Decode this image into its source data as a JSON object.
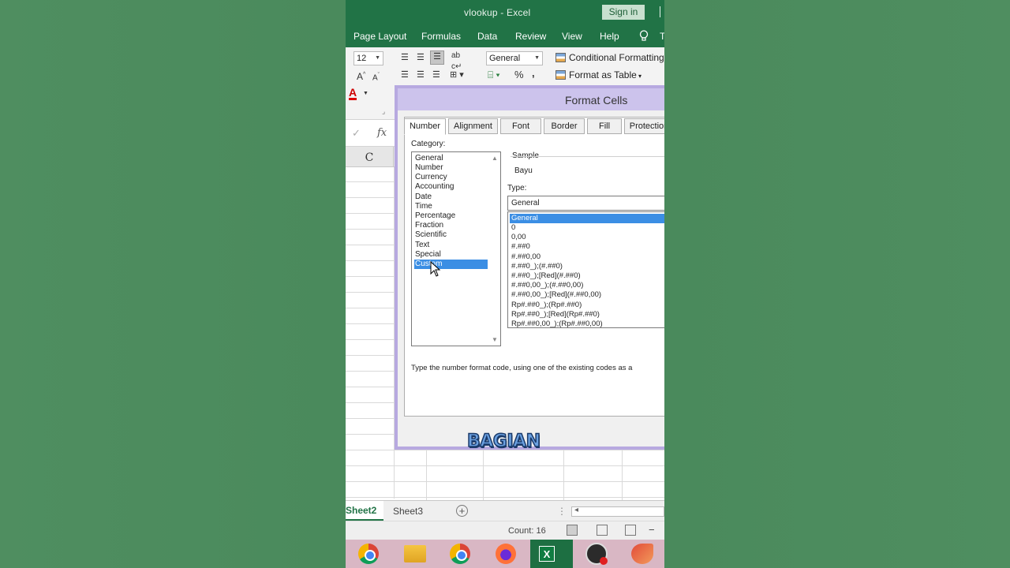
{
  "window": {
    "title": "vlookup - Excel",
    "sign_in": "Sign in"
  },
  "ribbon_tabs": [
    "Page Layout",
    "Formulas",
    "Data",
    "Review",
    "View",
    "Help",
    "T"
  ],
  "ribbon": {
    "font_size": "12",
    "number_format": "General",
    "conditional_formatting": "Conditional Formatting",
    "format_as_table": "Format as Table",
    "percent": "%",
    "comma": ","
  },
  "formula_bar": {
    "fx": "fx",
    "check": "✓"
  },
  "sheet": {
    "column_header": "C"
  },
  "dialog": {
    "title": "Format Cells",
    "tabs": [
      "Number",
      "Alignment",
      "Font",
      "Border",
      "Fill",
      "Protection"
    ],
    "active_tab": "Number",
    "category_label": "Category:",
    "categories": [
      "General",
      "Number",
      "Currency",
      "Accounting",
      "Date",
      "Time",
      "Percentage",
      "Fraction",
      "Scientific",
      "Text",
      "Special",
      "Custom"
    ],
    "selected_category": "Custom",
    "sample_label": "Sample",
    "sample_value": "Bayu",
    "type_label": "Type:",
    "type_value": "General",
    "type_list": [
      "General",
      "0",
      "0,00",
      "#.##0",
      "#.##0,00",
      "#.##0_);(#.##0)",
      "#.##0_);[Red](#.##0)",
      "#.##0,00_);(#.##0,00)",
      "#.##0,00_);[Red](#.##0,00)",
      "Rp#.##0_);(Rp#.##0)",
      "Rp#.##0_);[Red](Rp#.##0)",
      "Rp#.##0,00_);(Rp#.##0,00)"
    ],
    "selected_type": "General",
    "hint": "Type the number format code, using one of the existing codes as a"
  },
  "sheet_tabs": [
    "Sheet2",
    "Sheet3"
  ],
  "active_sheet": "Sheet2",
  "status": {
    "count": "Count: 16"
  },
  "caption": "BAGIAN",
  "colors": {
    "excel_green": "#217346",
    "dialog_border": "#b7a9e0",
    "selection": "#3b8ee4"
  }
}
